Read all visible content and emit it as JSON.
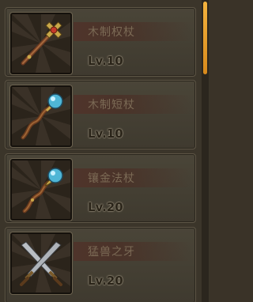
{
  "items": [
    {
      "name": "木制权杖",
      "level": "Lv.10",
      "icon": "cross-scepter-icon"
    },
    {
      "name": "木制短杖",
      "level": "Lv.10",
      "icon": "orb-short-staff-icon"
    },
    {
      "name": "镶金法杖",
      "level": "Lv.20",
      "icon": "gilded-orb-staff-icon"
    },
    {
      "name": "猛兽之牙",
      "level": "Lv.20",
      "icon": "crossed-blades-icon"
    }
  ],
  "colors": {
    "accent": "#f0a93a",
    "panel": "#3b352a",
    "orb": "#4fb6d6"
  }
}
